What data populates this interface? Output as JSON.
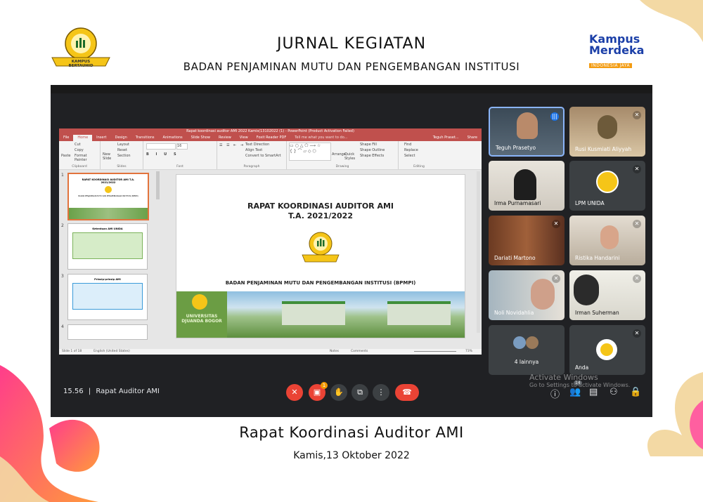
{
  "header": {
    "title": "JURNAL KEGIATAN",
    "subtitle": "BADAN PENJAMINAN MUTU DAN PENGEMBANGAN INSTITUSI",
    "left_logo_text": "KAMPUS BERTAUHID",
    "right_logo_line1": "Kampus",
    "right_logo_line2": "Merdeka",
    "right_logo_tag": "INDONESIA JAYA"
  },
  "meeting": {
    "time": "15.56",
    "meeting_name": "Rapat Auditor AMI",
    "separator": "|",
    "participants": [
      {
        "name": "Teguh Prasetyo",
        "speaking": true
      },
      {
        "name": "Rusi Kusmiati Aliyyah",
        "muted": true
      },
      {
        "name": "Irma Purnamasari",
        "muted": false
      },
      {
        "name": "LPM UNIDA",
        "muted": true
      },
      {
        "name": "Dariati Martono",
        "muted": true
      },
      {
        "name": "Ristika Handarini",
        "muted": true
      },
      {
        "name": "Noli Novidahlia",
        "muted": true
      },
      {
        "name": "Irman Suherman",
        "muted": true
      },
      {
        "name": "4 lainnya"
      },
      {
        "name": "Anda",
        "muted": true
      }
    ],
    "notification_badge": "1",
    "people_count": "14",
    "activate_windows_title": "Activate Windows",
    "activate_windows_sub": "Go to Settings to activate Windows.",
    "colors": {
      "end_call": "#ea4335",
      "mic_off": "#ea4335",
      "bg": "#202124",
      "tile": "#3c4043",
      "speaking_border": "#8ab4f8"
    }
  },
  "powerpoint": {
    "window_title": "Rapat koordinasi auditor AMI 2022 Kamis(13102022 (1) - PowerPoint (Product Activation Failed)",
    "tabs": [
      "File",
      "Home",
      "Insert",
      "Design",
      "Transitions",
      "Animations",
      "Slide Show",
      "Review",
      "View",
      "Foxit Reader PDF"
    ],
    "active_tab": "Home",
    "tell_me": "Tell me what you want to do...",
    "user": "Teguh Praset...",
    "share": "Share",
    "ribbon_groups": [
      "Clipboard",
      "Slides",
      "Font",
      "Paragraph",
      "Drawing",
      "Editing"
    ],
    "clipboard_items": [
      "Paste",
      "Cut",
      "Copy",
      "Format Painter"
    ],
    "slides_items": [
      "New Slide",
      "Layout",
      "Reset",
      "Section"
    ],
    "paragraph_items": [
      "Text Direction",
      "Align Text",
      "Convert to SmartArt"
    ],
    "drawing_items": [
      "Arrange",
      "Quick Styles",
      "Shape Fill",
      "Shape Outline",
      "Shape Effects"
    ],
    "editing_items": [
      "Find",
      "Replace",
      "Select"
    ],
    "font_size": "16",
    "thumbnails": [
      {
        "num": "1",
        "title": "RAPAT KOORDINASI AUDITOR AMI T.A. 2021/2022",
        "sub": "BADAN PENJAMINAN MUTU DAN PENGEMBANGAN INSTITUSI (BPMPI)"
      },
      {
        "num": "2",
        "title": "Ketentuan AMI UNIDA"
      },
      {
        "num": "3",
        "title": "Prinsip-prinsip AMI"
      },
      {
        "num": "4",
        "title": ""
      }
    ],
    "slide_title_line1": "RAPAT KOORDINASI AUDITOR AMI",
    "slide_title_line2": "T.A. 2021/2022",
    "slide_subtitle": "BADAN PENJAMINAN MUTU DAN PENGEMBANGAN INSTITUSI (BPMPI)",
    "slide_banner_text": "UNIVERSITAS DJUANDA BOGOR",
    "status_slide": "Slide 1 of 18",
    "status_lang": "English (United States)",
    "status_notes": "Notes",
    "status_comments": "Comments",
    "zoom": "73%"
  },
  "caption": {
    "title": "Rapat Koordinasi Auditor AMI",
    "date": "Kamis,13 Oktober 2022"
  }
}
